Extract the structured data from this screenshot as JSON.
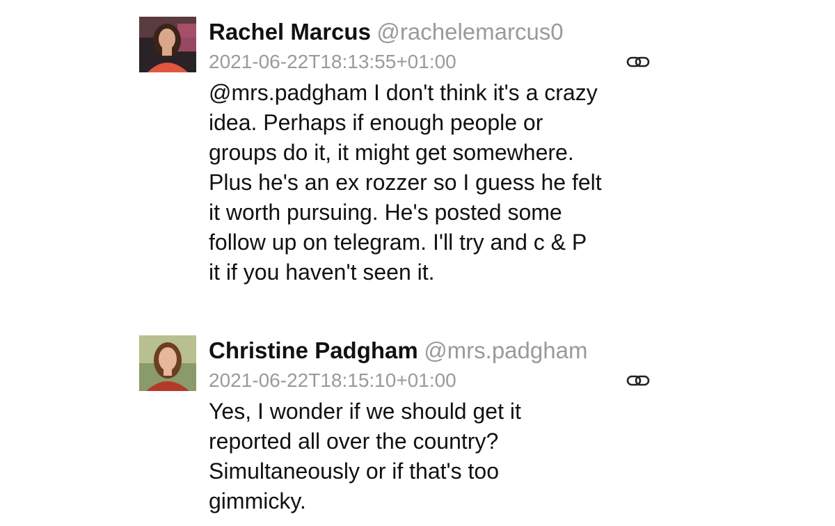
{
  "posts": [
    {
      "display_name": "Rachel Marcus",
      "handle": "@rachelemarcus0",
      "timestamp": "2021-06-22T18:13:55+01:00",
      "text": "@mrs.padgham I don't think it's a crazy\nidea. Perhaps if enough people or\ngroups do it, it might get somewhere.\nPlus he's an ex rozzer so I guess he felt\nit worth pursuing. He's posted some\nfollow up on telegram. I'll try and c & P\nit if you haven't seen it.",
      "avatar_icon": "avatar-photo",
      "link_icon": "chain-link-icon"
    },
    {
      "display_name": "Christine Padgham",
      "handle": "@mrs.padgham",
      "timestamp": "2021-06-22T18:15:10+01:00",
      "text": "Yes, I wonder if we should get it\nreported all over the country?\nSimultaneously or if that's too\ngimmicky.",
      "avatar_icon": "avatar-photo",
      "link_icon": "chain-link-icon"
    }
  ],
  "colors": {
    "text": "#111111",
    "muted": "#9a9a9a",
    "background": "#ffffff"
  }
}
